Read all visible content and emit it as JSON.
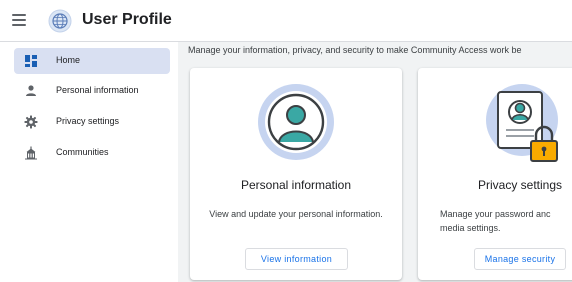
{
  "header": {
    "title": "User Profile",
    "menu_icon": "hamburger-menu-icon",
    "logo_icon": "globe-logo-icon"
  },
  "sidebar": {
    "items": [
      {
        "label": "Home",
        "icon": "dashboard-icon",
        "active": true
      },
      {
        "label": "Personal information",
        "icon": "person-icon",
        "active": false
      },
      {
        "label": "Privacy settings",
        "icon": "gear-icon",
        "active": false
      },
      {
        "label": "Communities",
        "icon": "building-icon",
        "active": false
      }
    ]
  },
  "main": {
    "intro": "Manage your information, privacy, and security to make Community Access work be",
    "cards": [
      {
        "title": "Personal information",
        "description": "View and update your personal information.",
        "button": "View information",
        "icon": "person-circle-icon"
      },
      {
        "title": "Privacy settings",
        "description": "Manage your password and media settings.",
        "description_visible": "Manage your password anc\nmedia settings.",
        "button": "Manage security",
        "icon": "document-lock-icon"
      }
    ]
  },
  "colors": {
    "accent": "#1a73e8",
    "nav_active_bg": "#d9e0f2",
    "illustration_teal": "#3aa8a4",
    "illustration_bg": "#c6d4f0",
    "lock_yellow": "#f9ab00"
  }
}
